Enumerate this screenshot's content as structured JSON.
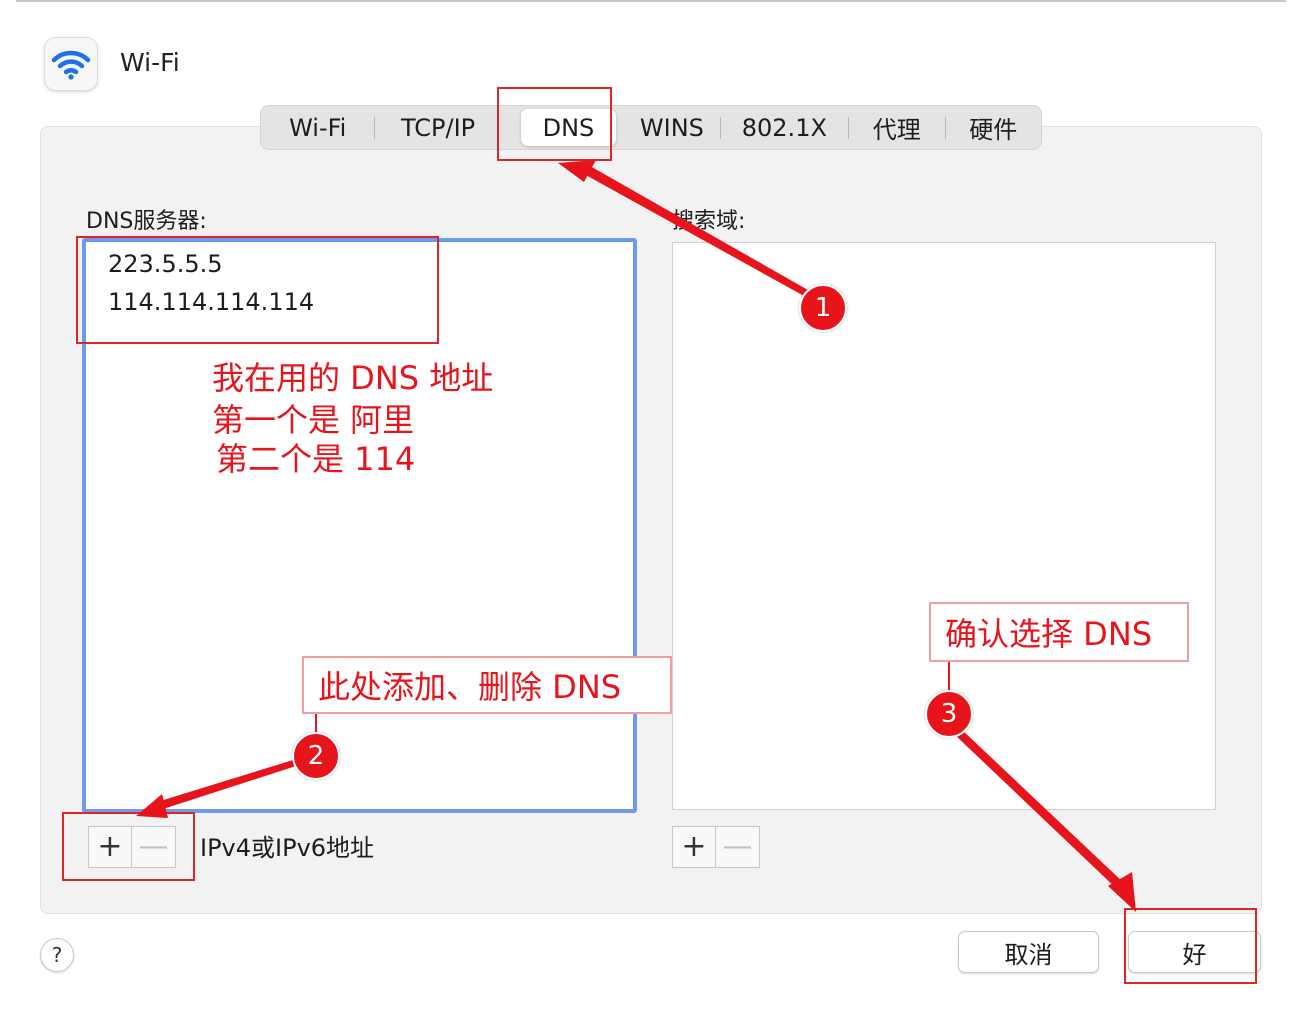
{
  "window": {
    "title": "Wi-Fi",
    "icon": "wifi-icon"
  },
  "tabs": [
    {
      "label": "Wi-Fi",
      "active": false
    },
    {
      "label": "TCP/IP",
      "active": false
    },
    {
      "label": "DNS",
      "active": true
    },
    {
      "label": "WINS",
      "active": false
    },
    {
      "label": "802.1X",
      "active": false
    },
    {
      "label": "代理",
      "active": false
    },
    {
      "label": "硬件",
      "active": false
    }
  ],
  "dns": {
    "label": "DNS服务器:",
    "servers": [
      "223.5.5.5",
      "114.114.114.114"
    ],
    "hint": "IPv4或IPv6地址",
    "add_symbol": "+",
    "remove_symbol": "—"
  },
  "search_domains": {
    "label": "搜索域:",
    "add_symbol": "+",
    "remove_symbol": "—"
  },
  "footer": {
    "help_symbol": "?",
    "cancel_label": "取消",
    "ok_label": "好"
  },
  "annotations": {
    "note_main": [
      "我在用的 DNS 地址",
      "第一个是 阿里",
      "第二个是 114"
    ],
    "note_add_remove": "此处添加、删除 DNS",
    "note_confirm": "确认选择 DNS",
    "badges": [
      "1",
      "2",
      "3"
    ],
    "color": "#e8141c"
  }
}
